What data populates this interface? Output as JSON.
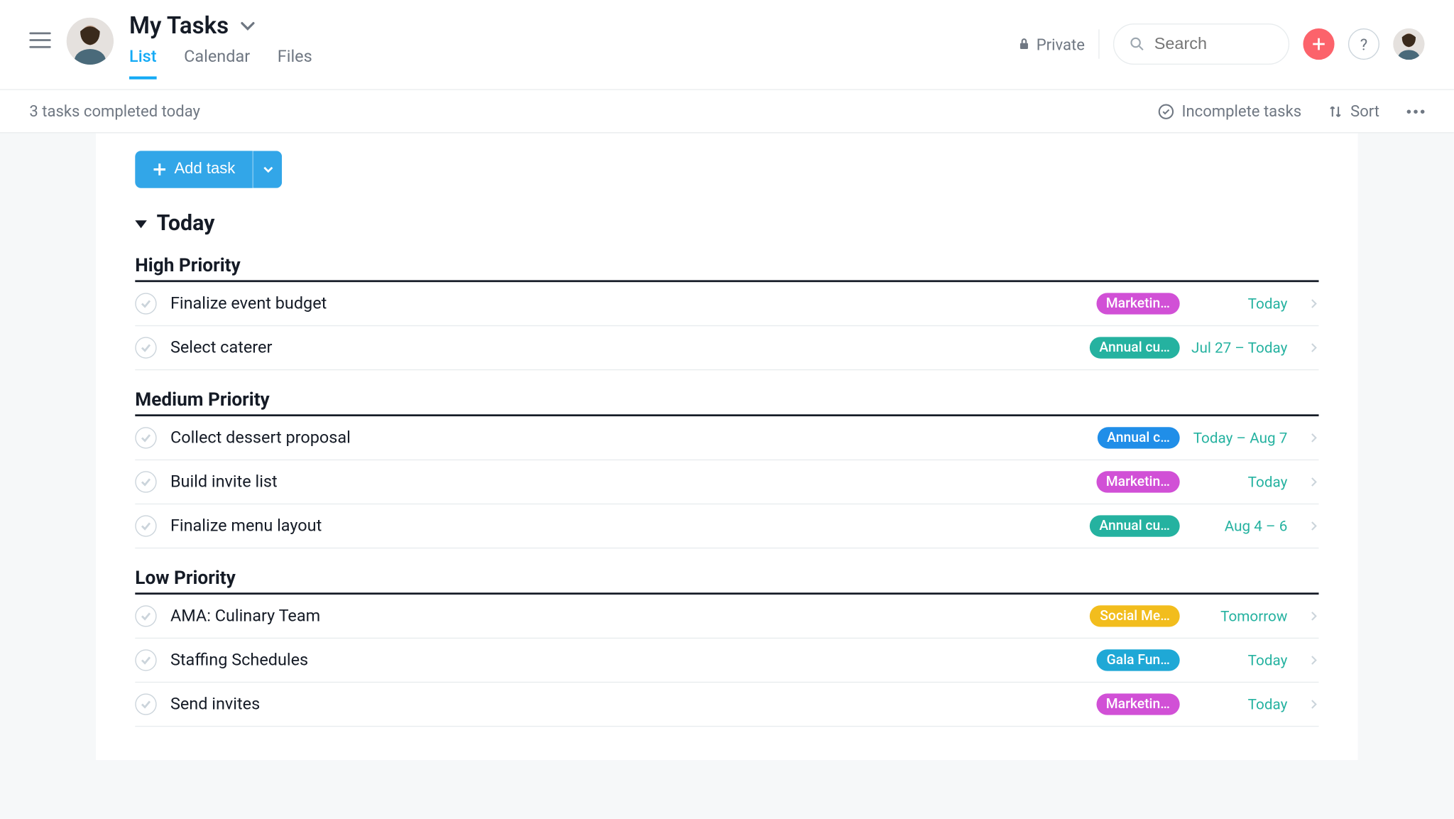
{
  "header": {
    "title": "My Tasks",
    "tabs": [
      {
        "label": "List",
        "active": true
      },
      {
        "label": "Calendar",
        "active": false
      },
      {
        "label": "Files",
        "active": false
      }
    ],
    "private_label": "Private",
    "search_placeholder": "Search"
  },
  "toolbar": {
    "status": "3 tasks completed today",
    "filter_label": "Incomplete tasks",
    "sort_label": "Sort"
  },
  "add_task_label": "Add task",
  "section": {
    "title": "Today"
  },
  "groups": [
    {
      "name": "High Priority",
      "tasks": [
        {
          "title": "Finalize event budget",
          "project": "Marketin…",
          "pill": "magenta",
          "date": "Today"
        },
        {
          "title": "Select caterer",
          "project": "Annual cu…",
          "pill": "teal",
          "date": "Jul 27 – Today"
        }
      ]
    },
    {
      "name": "Medium Priority",
      "tasks": [
        {
          "title": "Collect dessert proposal",
          "project": "Annual c…",
          "pill": "blue",
          "date": "Today – Aug 7"
        },
        {
          "title": "Build invite list",
          "project": "Marketin…",
          "pill": "magenta",
          "date": "Today"
        },
        {
          "title": "Finalize menu layout",
          "project": "Annual cu…",
          "pill": "teal",
          "date": "Aug 4 – 6"
        }
      ]
    },
    {
      "name": "Low Priority",
      "tasks": [
        {
          "title": "AMA: Culinary Team",
          "project": "Social Me…",
          "pill": "yellow",
          "date": "Tomorrow"
        },
        {
          "title": "Staffing Schedules",
          "project": "Gala Fun…",
          "pill": "cyan",
          "date": "Today"
        },
        {
          "title": "Send invites",
          "project": "Marketin…",
          "pill": "magenta",
          "date": "Today"
        }
      ]
    }
  ]
}
